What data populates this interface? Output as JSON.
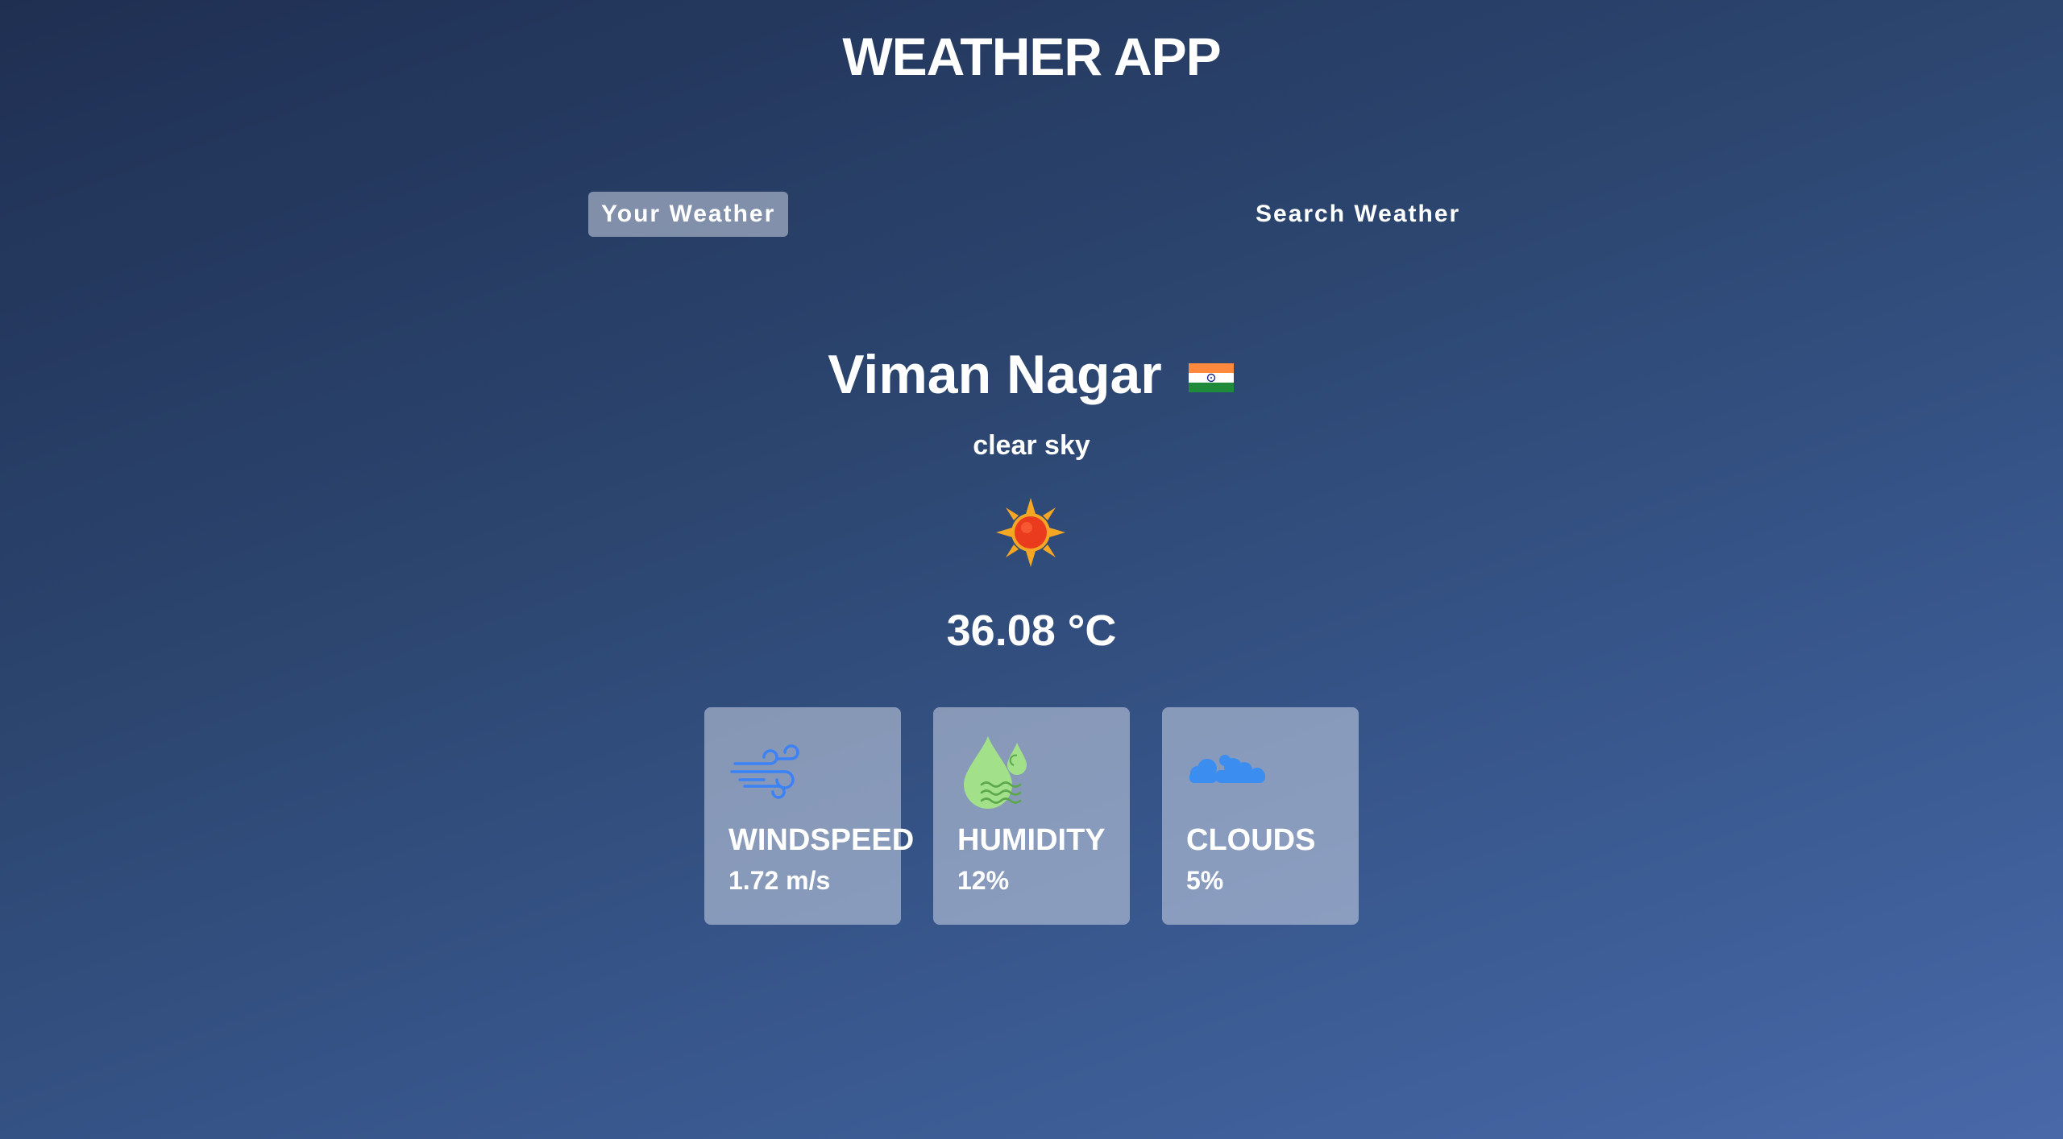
{
  "header": {
    "title": "WEATHER APP"
  },
  "tabs": [
    {
      "label": "Your Weather",
      "active": true
    },
    {
      "label": "Search Weather",
      "active": false
    }
  ],
  "weather": {
    "city": "Viman Nagar",
    "country_flag_icon": "india-flag-icon",
    "description": "clear sky",
    "condition_icon": "sun-icon",
    "temperature": "36.08 °C"
  },
  "stats": [
    {
      "label": "WINDSPEED",
      "value": "1.72 m/s",
      "icon": "wind-icon"
    },
    {
      "label": "HUMIDITY",
      "value": "12%",
      "icon": "humidity-icon"
    },
    {
      "label": "CLOUDS",
      "value": "5%",
      "icon": "clouds-icon"
    }
  ],
  "colors": {
    "background_start": "#1f2f52",
    "background_end": "#4868a8",
    "card_bg": "rgba(219,226,239,0.5)",
    "wind_icon": "#3b82f6",
    "humidity_icon": "#a3e08a",
    "clouds_icon": "#3b8ef0",
    "sun": "#ea3b1f"
  }
}
